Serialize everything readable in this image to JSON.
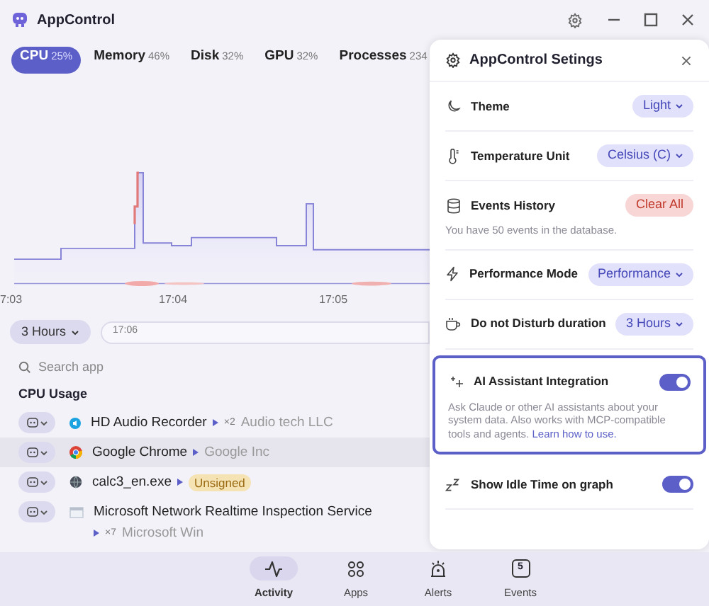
{
  "window": {
    "title": "AppControl"
  },
  "metric_tabs": [
    {
      "label": "CPU",
      "value": "25%",
      "selected": true
    },
    {
      "label": "Memory",
      "value": "46%",
      "selected": false
    },
    {
      "label": "Disk",
      "value": "32%",
      "selected": false
    },
    {
      "label": "GPU",
      "value": "32%",
      "selected": false
    },
    {
      "label": "Processes",
      "value": "234",
      "selected": false
    }
  ],
  "time_axis": [
    "7:03",
    "17:04",
    "17:05"
  ],
  "range_select": {
    "value": "3 Hours"
  },
  "timeline": {
    "label": "17:06"
  },
  "search": {
    "placeholder": "Search app"
  },
  "section_title": "CPU Usage",
  "apps": [
    {
      "name": "HD Audio Recorder",
      "count": "×2",
      "publisher": "Audio tech LLC",
      "selected": false
    },
    {
      "name": "Google Chrome",
      "publisher": "Google Inc",
      "selected": true
    },
    {
      "name": "calc3_en.exe",
      "badge": "Unsigned",
      "selected": false
    },
    {
      "name": "Microsoft Network Realtime Inspection Service",
      "count": "×7",
      "publisher": "Microsoft Win",
      "selected": false
    }
  ],
  "settings": {
    "title": "AppControl Setings",
    "items": [
      {
        "kind": "select",
        "label": "Theme",
        "value": "Light",
        "highlighted": false
      },
      {
        "kind": "select",
        "label": "Temperature Unit",
        "value": "Celsius (C)",
        "highlighted": false
      },
      {
        "kind": "button",
        "label": "Events History",
        "button": "Clear All",
        "description": "You have 50 events in the database.",
        "highlighted": false
      },
      {
        "kind": "select",
        "label": "Performance Mode",
        "value": "Performance",
        "highlighted": false
      },
      {
        "kind": "select",
        "label": "Do not Disturb duration",
        "value": "3 Hours",
        "highlighted": false
      },
      {
        "kind": "toggle",
        "label": "AI Assistant Integration",
        "on": true,
        "description": "Ask Claude or other AI assistants about your system data. Also works with MCP-compatible tools and agents.",
        "link": "Learn how to use.",
        "highlighted": true
      },
      {
        "kind": "toggle",
        "label": "Show Idle Time on graph",
        "on": true,
        "highlighted": false
      }
    ]
  },
  "nav": [
    {
      "label": "Activity",
      "selected": true
    },
    {
      "label": "Apps",
      "selected": false
    },
    {
      "label": "Alerts",
      "selected": false
    },
    {
      "label": "Events",
      "badge": "5",
      "selected": false
    }
  ]
}
